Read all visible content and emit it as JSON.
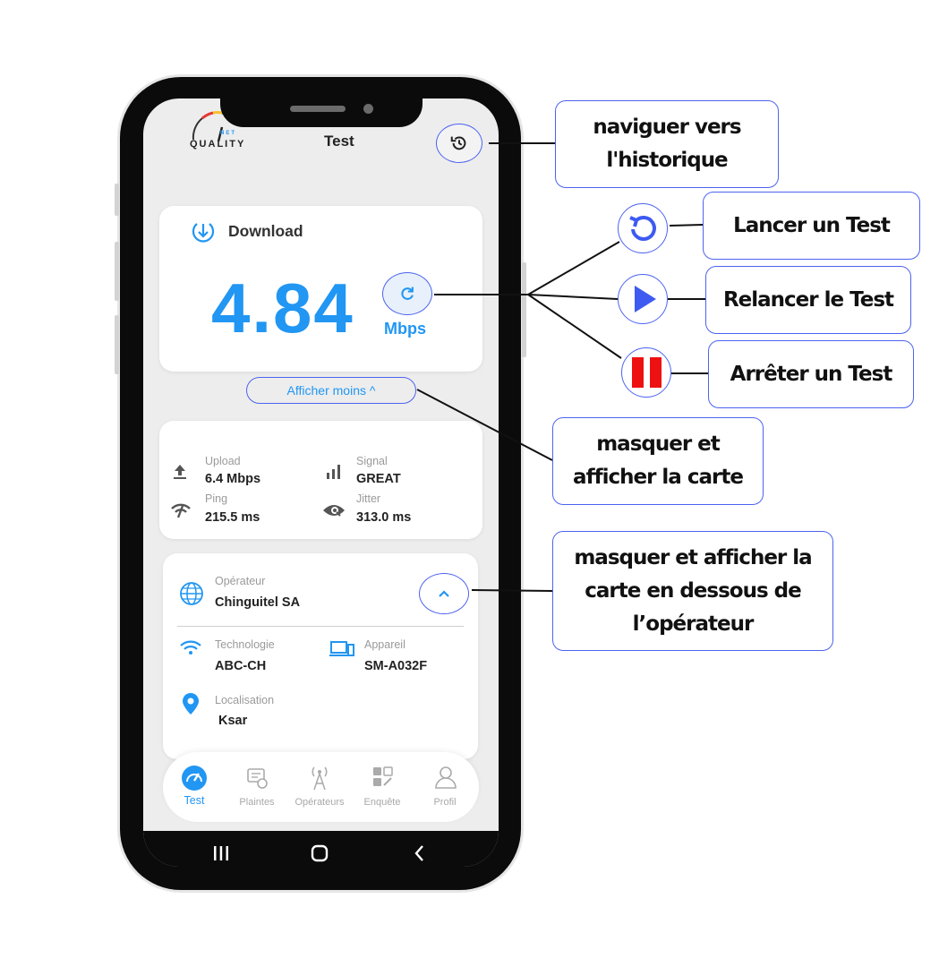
{
  "header": {
    "logo_text": "QUALITY",
    "logo_sub": "NET",
    "title": "Test"
  },
  "download_card": {
    "label": "Download",
    "speed": "4.84",
    "unit": "Mbps"
  },
  "toggle": {
    "label": "Afficher moins ^"
  },
  "metrics": {
    "upload": {
      "label": "Upload",
      "value": "6.4 Mbps"
    },
    "signal": {
      "label": "Signal",
      "value": "GREAT"
    },
    "ping": {
      "label": "Ping",
      "value": "215.5 ms"
    },
    "jitter": {
      "label": "Jitter",
      "value": "313.0 ms"
    }
  },
  "operator_card": {
    "operator_label": "Opérateur",
    "operator_value": "Chinguitel SA",
    "technology_label": "Technologie",
    "technology_value": "ABC-CH",
    "device_label": "Appareil",
    "device_value": "SM-A032F",
    "location_label": "Localisation",
    "location_value": "Ksar"
  },
  "bottom_nav": [
    {
      "label": "Test",
      "active": true
    },
    {
      "label": "Plaintes",
      "active": false
    },
    {
      "label": "Opérateurs",
      "active": false
    },
    {
      "label": "Enquête",
      "active": false
    },
    {
      "label": "Profil",
      "active": false
    }
  ],
  "callouts": {
    "history": [
      "naviguer vers",
      "l'historique"
    ],
    "launch": "Lancer un Test",
    "relaunch": "Relancer le Test",
    "stop": "Arrêter un Test",
    "toggle_card": [
      "masquer et",
      "afficher la carte"
    ],
    "toggle_operator": [
      "masquer et afficher la",
      "carte en dessous de",
      "l’opérateur"
    ]
  },
  "colors": {
    "accent": "#2196f3",
    "callout_border": "#4c63f0",
    "stop_red": "#ee1111",
    "play_blue": "#3d5af1"
  }
}
